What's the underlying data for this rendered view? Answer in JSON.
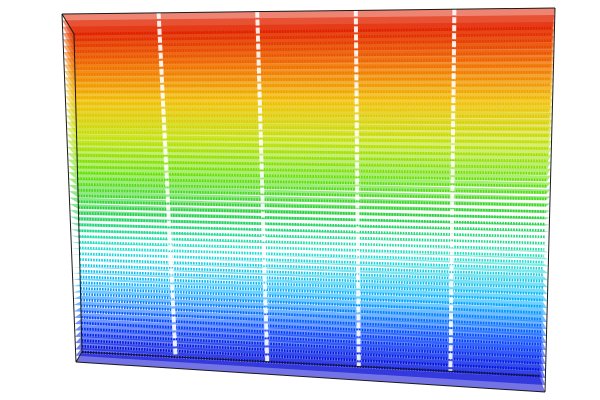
{
  "scene": {
    "kind": "3d-scatter-volume",
    "background": "#ffffff",
    "box_edge_color": "#1a1a1a",
    "colormap": "jet",
    "colormap_stops": [
      "#0000d0",
      "#0040ff",
      "#00b0ff",
      "#20e0d0",
      "#20d040",
      "#60e000",
      "#c0e000",
      "#f0c000",
      "#f07000",
      "#e02000"
    ],
    "layer_count": 56,
    "column_blocks": 5,
    "show_axes": false,
    "show_legend": false
  }
}
